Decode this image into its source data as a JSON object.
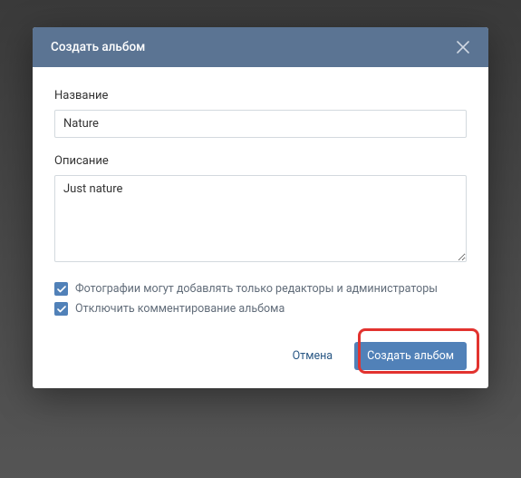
{
  "modal": {
    "title": "Создать альбом",
    "nameLabel": "Название",
    "nameValue": "Nature",
    "descLabel": "Описание",
    "descValue": "Just nature",
    "checkbox1": "Фотографии могут добавлять только редакторы и администраторы",
    "checkbox2": "Отключить комментирование альбома",
    "cancel": "Отмена",
    "submit": "Создать альбом"
  }
}
